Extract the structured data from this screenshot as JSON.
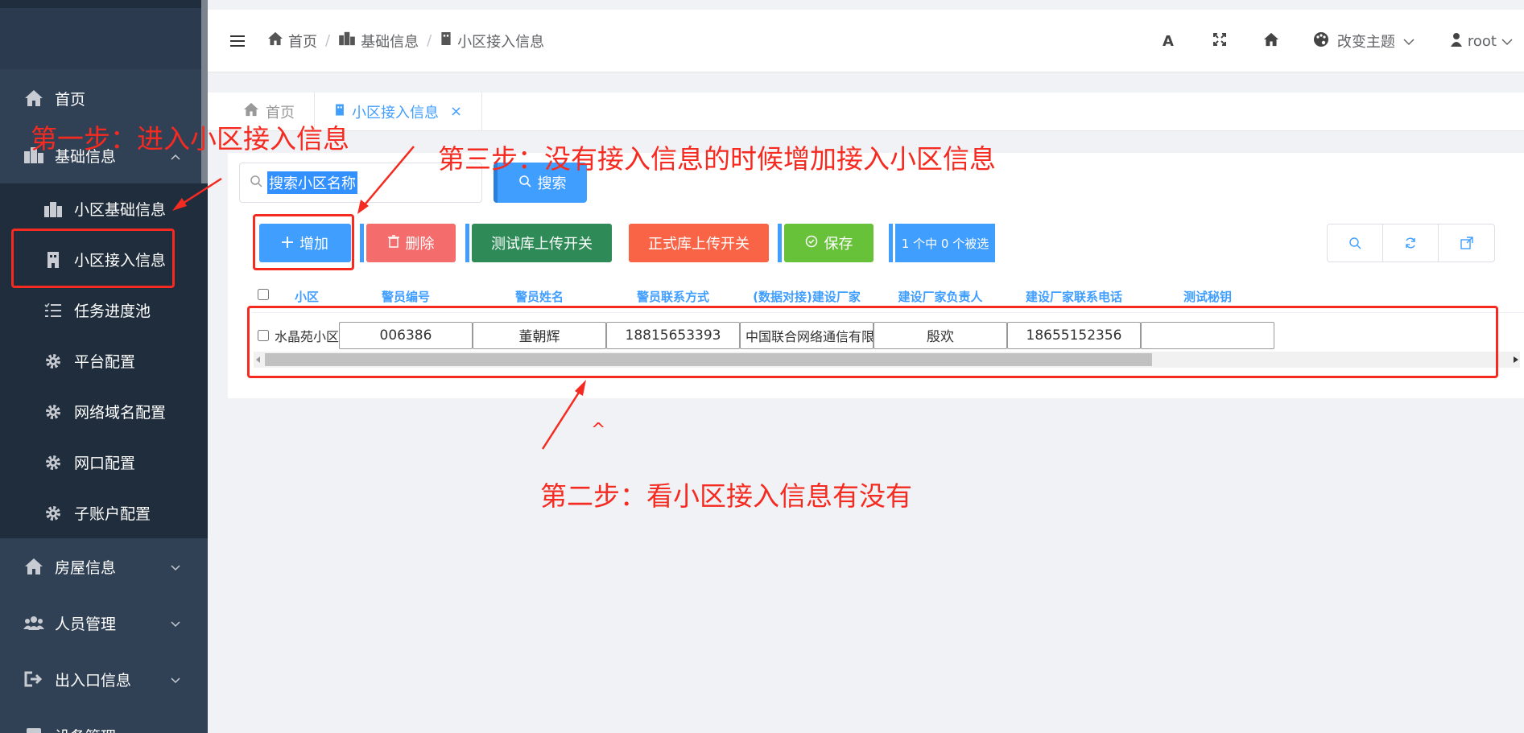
{
  "sidebar": {
    "top_item": "首页",
    "group_basic": "基础信息",
    "sub_items": [
      "小区基础信息",
      "小区接入信息",
      "任务进度池",
      "平台配置",
      "网络域名配置",
      "网口配置",
      "子账户配置"
    ],
    "group_items": [
      "房屋信息",
      "人员管理",
      "出入口信息",
      "设备管理"
    ]
  },
  "header": {
    "breadcrumb": [
      "首页",
      "基础信息",
      "小区接入信息"
    ],
    "breadcrumb_sep": "/",
    "font_icon": "A",
    "theme_label": "改变主题",
    "user": "root"
  },
  "tabs": [
    {
      "label": "首页"
    },
    {
      "label": "小区接入信息",
      "close": "×"
    }
  ],
  "search": {
    "placeholder": "搜索小区名称",
    "button": "搜索"
  },
  "toolbar": {
    "add": "增加",
    "delete": "删除",
    "test_upload": "测试库上传开关",
    "prod_upload": "正式库上传开关",
    "save": "保存",
    "selection": "1 个中 0 个被选"
  },
  "table": {
    "columns": [
      "小区",
      "警员编号",
      "警员姓名",
      "警员联系方式",
      "(数据对接)建设厂家",
      "建设厂家负责人",
      "建设厂家联系电话",
      "测试秘钥"
    ],
    "rows": [
      [
        "水晶苑小区",
        "006386",
        "董朝辉",
        "18815653393",
        "中国联合网络通信有限",
        "殷欢",
        "18655152356",
        ""
      ]
    ]
  },
  "annotations": {
    "step1": "第一步：进入小区接入信息",
    "step2": "第二步：看小区接入信息有没有",
    "step3": "第三步：没有接入信息的时候增加接入小区信息",
    "caret": "^"
  },
  "colors": {
    "sidebar_bg": "#304156",
    "submenu_bg": "#1f2d3d",
    "primary": "#409eff",
    "danger": "#f56c6c",
    "success_dark": "#2e8b57",
    "warning": "#f96447",
    "success": "#67c23a",
    "annotation": "#f52a20"
  }
}
